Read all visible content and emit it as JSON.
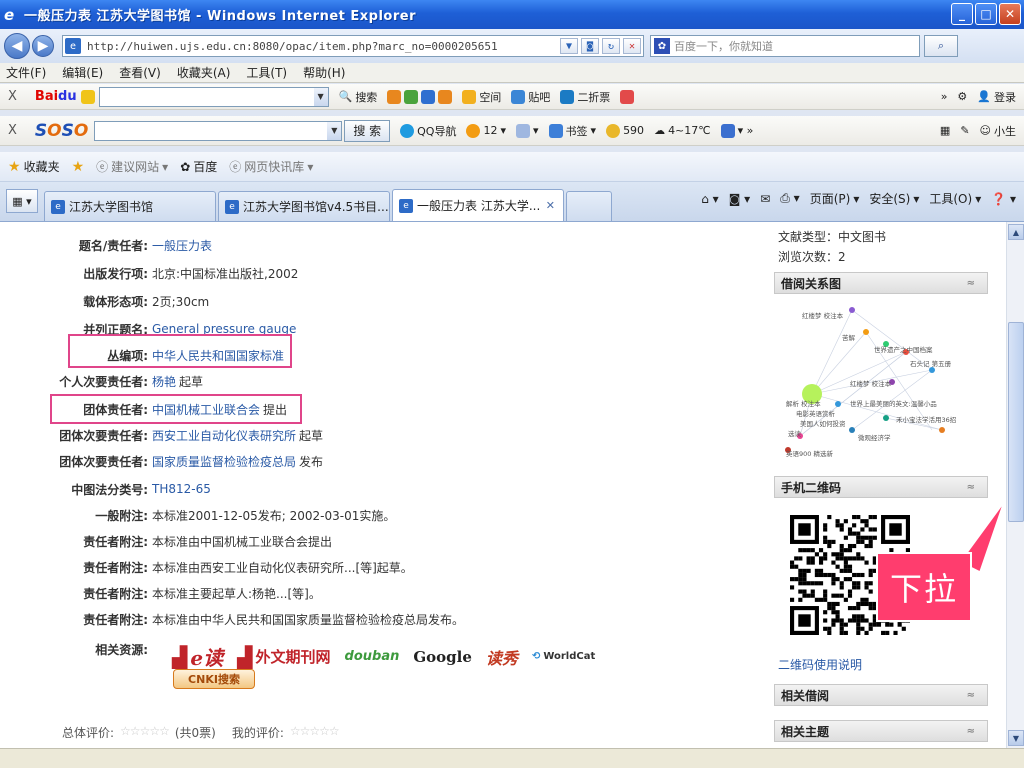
{
  "window": {
    "title": "一般压力表 江苏大学图书馆 - Windows Internet Explorer",
    "min": "_",
    "max": "□",
    "close": "✕"
  },
  "address": {
    "url": "http://huiwen.ujs.edu.cn:8080/opac/item.php?marc_no=0000205651",
    "search_placeholder": "百度一下，你就知道"
  },
  "menu": [
    "文件(F)",
    "编辑(E)",
    "查看(V)",
    "收藏夹(A)",
    "工具(T)",
    "帮助(H)"
  ],
  "baidu_bar": {
    "close": "X",
    "search_btn": "搜索",
    "items": [
      "空间",
      "贴吧",
      "二折票"
    ],
    "login": "登录"
  },
  "soso_bar": {
    "close": "X",
    "search_btn": "搜 索",
    "items": [
      "QQ导航",
      "12",
      "书签",
      "590",
      "4~17℃"
    ],
    "user": "小生"
  },
  "favorites": {
    "label": "收藏夹",
    "items": [
      "建议网站",
      "百度",
      "网页快讯库"
    ]
  },
  "tabs": [
    {
      "label": "江苏大学图书馆"
    },
    {
      "label": "江苏大学图书馆v4.5书目..."
    },
    {
      "label": "一般压力表 江苏大学..."
    }
  ],
  "commands": [
    "页面(P)",
    "安全(S)",
    "工具(O)"
  ],
  "record": [
    {
      "label": "题名/责任者:",
      "value": "一般压力表",
      "link": true
    },
    {
      "label": "出版发行项:",
      "value": "北京:中国标准出版社,2002"
    },
    {
      "label": "载体形态项:",
      "value": "2页;30cm"
    },
    {
      "label": "并列正题名:",
      "value": "General pressure gauge",
      "link": true
    },
    {
      "label": "丛编项:",
      "value": "中华人民共和国国家标准",
      "link": true
    },
    {
      "label": "个人次要责任者:",
      "value": "杨艳",
      "suffix": "起草",
      "link": true
    },
    {
      "label": "团体责任者:",
      "value": "中国机械工业联合会",
      "suffix": "提出",
      "link": true
    },
    {
      "label": "团体次要责任者:",
      "value": "西安工业自动化仪表研究所",
      "suffix": "起草",
      "link": true
    },
    {
      "label": "团体次要责任者:",
      "value": "国家质量监督检验检疫总局",
      "suffix": "发布",
      "link": true
    },
    {
      "label": "中图法分类号:",
      "value": "TH812-65",
      "link": true
    },
    {
      "label": "一般附注:",
      "value": "本标准2001-12-05发布; 2002-03-01实施。"
    },
    {
      "label": "责任者附注:",
      "value": "本标准由中国机械工业联合会提出"
    },
    {
      "label": "责任者附注:",
      "value": "本标准由西安工业自动化仪表研究所...[等]起草。"
    },
    {
      "label": "责任者附注:",
      "value": "本标准主要起草人:杨艳...[等]。"
    },
    {
      "label": "责任者附注:",
      "value": "本标准由中华人民共和国国家质量监督检验检疫总局发布。"
    }
  ],
  "resources": {
    "label": "相关资源:",
    "ebook": "e读",
    "waiwen": "外文期刊网",
    "douban": "douban",
    "google": "Google",
    "dushu": "读秀",
    "worldcat": "WorldCat",
    "cnki": "CNKI搜索"
  },
  "rating": {
    "total_label": "总体评价:",
    "votes": "(共0票)",
    "mine_label": "我的评价:",
    "stars": "☆☆☆☆☆"
  },
  "side": {
    "doc_type": "文献类型：中文图书",
    "views": "浏览次数：2",
    "borrow_graph_title": "借阅关系图",
    "graph_nodes": [
      "红楼梦 校注本",
      "苦解",
      "世界遗产之中国档案",
      "石头记 第五册",
      "红楼梦 校注本",
      "解析 校注本",
      "世界上最美丽的英文:温馨小品",
      "电影英语赏析",
      "美国人如何投资",
      "禾小宝法学活用36招",
      "选读",
      "微观经济学",
      "英语900 精选新"
    ],
    "qr_title": "手机二维码",
    "qr_link": "二维码使用说明",
    "related_borrow": "相关借阅",
    "related_topic": "相关主题",
    "chevron": "≈"
  },
  "callout": "下拉"
}
